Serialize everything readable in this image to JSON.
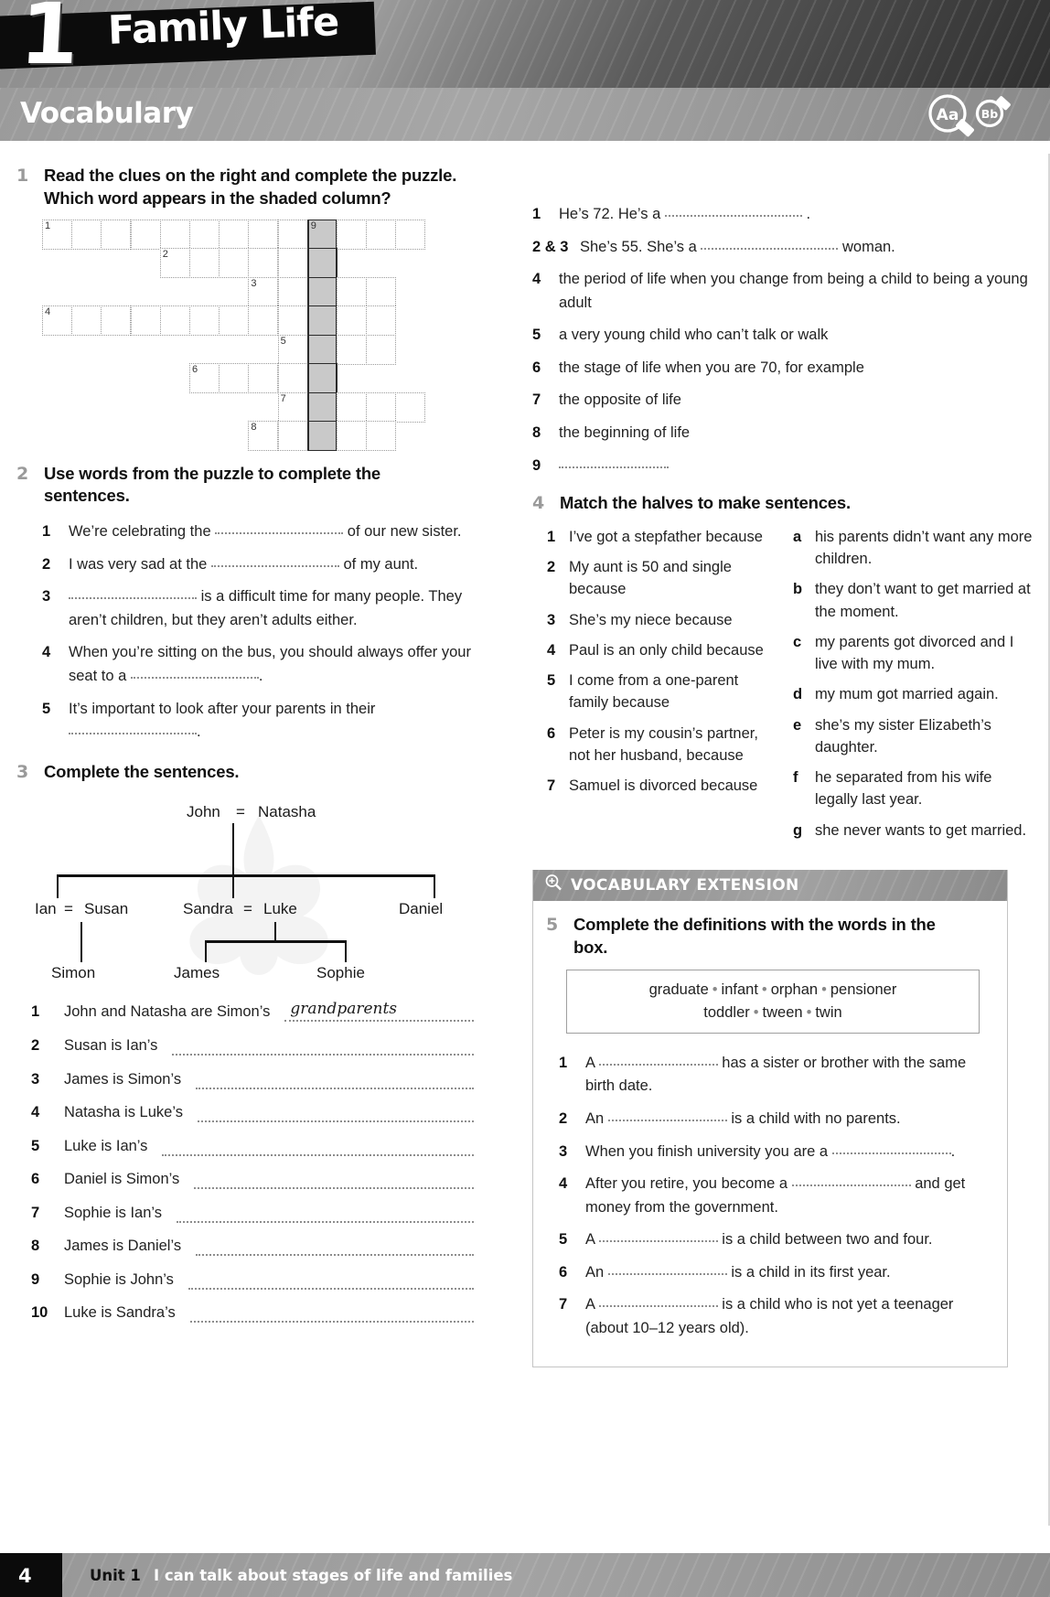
{
  "header": {
    "unit_number": "1",
    "unit_title": "Family Life",
    "skill": "Vocabulary",
    "icon_aa": "Aa",
    "icon_bb": "Bb"
  },
  "ex1": {
    "number": "1",
    "title": "Read the clues on the right and complete the puzzle. Which word appears in the shaded column?",
    "clues": [
      {
        "n": "1",
        "text_before": "He’s 72. He’s a",
        "text_after": ".",
        "blank": true
      },
      {
        "n": "2 & 3",
        "text_before": "She’s 55. She’s a",
        "text_after": "woman.",
        "blank": true
      },
      {
        "n": "4",
        "text_before": "the period of life when you change from being a child to being a young adult",
        "text_after": "",
        "blank": false
      },
      {
        "n": "5",
        "text_before": "a very young child who can’t talk or walk",
        "text_after": "",
        "blank": false
      },
      {
        "n": "6",
        "text_before": "the stage of life when you are 70, for example",
        "text_after": "",
        "blank": false
      },
      {
        "n": "7",
        "text_before": "the opposite of life",
        "text_after": "",
        "blank": false
      },
      {
        "n": "8",
        "text_before": "the beginning of life",
        "text_after": "",
        "blank": false
      },
      {
        "n": "9",
        "text_before": "",
        "text_after": "",
        "blank": true
      }
    ],
    "crossword": {
      "shaded_column": 9,
      "rows": [
        {
          "label": "1",
          "start": 0,
          "length": 13
        },
        {
          "label": "2",
          "start": 4,
          "length": 6
        },
        {
          "label": "3",
          "start": 7,
          "length": 5
        },
        {
          "label": "4",
          "start": 0,
          "length": 12
        },
        {
          "label": "5",
          "start": 8,
          "length": 4
        },
        {
          "label": "6",
          "start": 5,
          "length": 5
        },
        {
          "label": "7",
          "start": 8,
          "length": 5
        },
        {
          "label": "8",
          "start": 7,
          "length": 5
        }
      ]
    }
  },
  "ex2": {
    "number": "2",
    "title": "Use words from the puzzle to complete the sentences.",
    "items": [
      {
        "n": "1",
        "parts": [
          "We’re celebrating the ",
          " of our new sister."
        ]
      },
      {
        "n": "2",
        "parts": [
          "I was very sad at the ",
          " of my aunt."
        ]
      },
      {
        "n": "3",
        "parts": [
          "",
          " is a difficult time for many people. They aren’t children, but they aren’t adults either."
        ]
      },
      {
        "n": "4",
        "parts": [
          "When you’re sitting on the bus, you should always offer your seat to a ",
          "."
        ]
      },
      {
        "n": "5",
        "parts": [
          "It’s important to look after your parents in their ",
          "."
        ]
      }
    ]
  },
  "ex3": {
    "number": "3",
    "title": "Complete the sentences.",
    "tree": {
      "generation1": [
        "John",
        "Natasha"
      ],
      "generation2": [
        [
          "Ian",
          "Susan"
        ],
        [
          "Sandra",
          "Luke"
        ],
        [
          "Daniel"
        ]
      ],
      "generation3": [
        "Simon",
        "James",
        "Sophie"
      ],
      "equals": "="
    },
    "items": [
      {
        "n": "1",
        "text": "John and Natasha are Simon’s",
        "answer": "grandparents"
      },
      {
        "n": "2",
        "text": "Susan is Ian’s",
        "answer": ""
      },
      {
        "n": "3",
        "text": "James is Simon’s",
        "answer": ""
      },
      {
        "n": "4",
        "text": "Natasha is Luke’s",
        "answer": ""
      },
      {
        "n": "5",
        "text": "Luke is Ian’s",
        "answer": ""
      },
      {
        "n": "6",
        "text": "Daniel is Simon’s",
        "answer": ""
      },
      {
        "n": "7",
        "text": "Sophie is Ian’s",
        "answer": ""
      },
      {
        "n": "8",
        "text": "James is Daniel’s",
        "answer": ""
      },
      {
        "n": "9",
        "text": "Sophie is John’s",
        "answer": ""
      },
      {
        "n": "10",
        "text": "Luke is Sandra’s",
        "answer": ""
      }
    ]
  },
  "ex4": {
    "number": "4",
    "title": "Match the halves to make sentences.",
    "left": [
      {
        "n": "1",
        "text": "I’ve got a stepfather because"
      },
      {
        "n": "2",
        "text": "My aunt is 50 and single because"
      },
      {
        "n": "3",
        "text": "She’s my niece because"
      },
      {
        "n": "4",
        "text": "Paul is an only child because"
      },
      {
        "n": "5",
        "text": "I come from a one-parent family because"
      },
      {
        "n": "6",
        "text": "Peter is my cousin’s partner, not her husband, because"
      },
      {
        "n": "7",
        "text": "Samuel is divorced because"
      }
    ],
    "right": [
      {
        "n": "a",
        "text": "his parents didn’t want any more children."
      },
      {
        "n": "b",
        "text": "they don’t want to get married at the moment."
      },
      {
        "n": "c",
        "text": "my parents got divorced and I live with my mum."
      },
      {
        "n": "d",
        "text": "my mum got married again."
      },
      {
        "n": "e",
        "text": "she’s my sister Elizabeth’s daughter."
      },
      {
        "n": "f",
        "text": "he separated from his wife legally last year."
      },
      {
        "n": "g",
        "text": "she never wants to get married."
      }
    ]
  },
  "ex5": {
    "panel_label": "VOCABULARY EXTENSION",
    "number": "5",
    "title": "Complete the definitions with the words in the box.",
    "wordbox_line1": [
      "graduate",
      "infant",
      "orphan",
      "pensioner"
    ],
    "wordbox_line2": [
      "toddler",
      "tween",
      "twin"
    ],
    "items": [
      {
        "n": "1",
        "parts": [
          "A ",
          " has a sister or brother with the same birth date."
        ]
      },
      {
        "n": "2",
        "parts": [
          "An ",
          " is a child with no parents."
        ]
      },
      {
        "n": "3",
        "parts": [
          "When you finish university you are a ",
          "."
        ]
      },
      {
        "n": "4",
        "parts": [
          "After you retire, you become a ",
          " and get money from the government."
        ]
      },
      {
        "n": "5",
        "parts": [
          "A ",
          " is a child between two and four."
        ]
      },
      {
        "n": "6",
        "parts": [
          "An ",
          " is a child in its first year."
        ]
      },
      {
        "n": "7",
        "parts": [
          "A ",
          " is a child who is not yet a teenager (about 10–12 years old)."
        ]
      }
    ]
  },
  "footer": {
    "page": "4",
    "unit": "Unit 1",
    "can_do": "I can talk about stages of life and families"
  },
  "colors": {
    "banner_dark": "#2f2f2f",
    "banner_light": "#9d9d9d",
    "shade_cell": "#c9c9c9",
    "blank_dots": "#8d8d8d",
    "ex_number": "#9a9a9a"
  }
}
